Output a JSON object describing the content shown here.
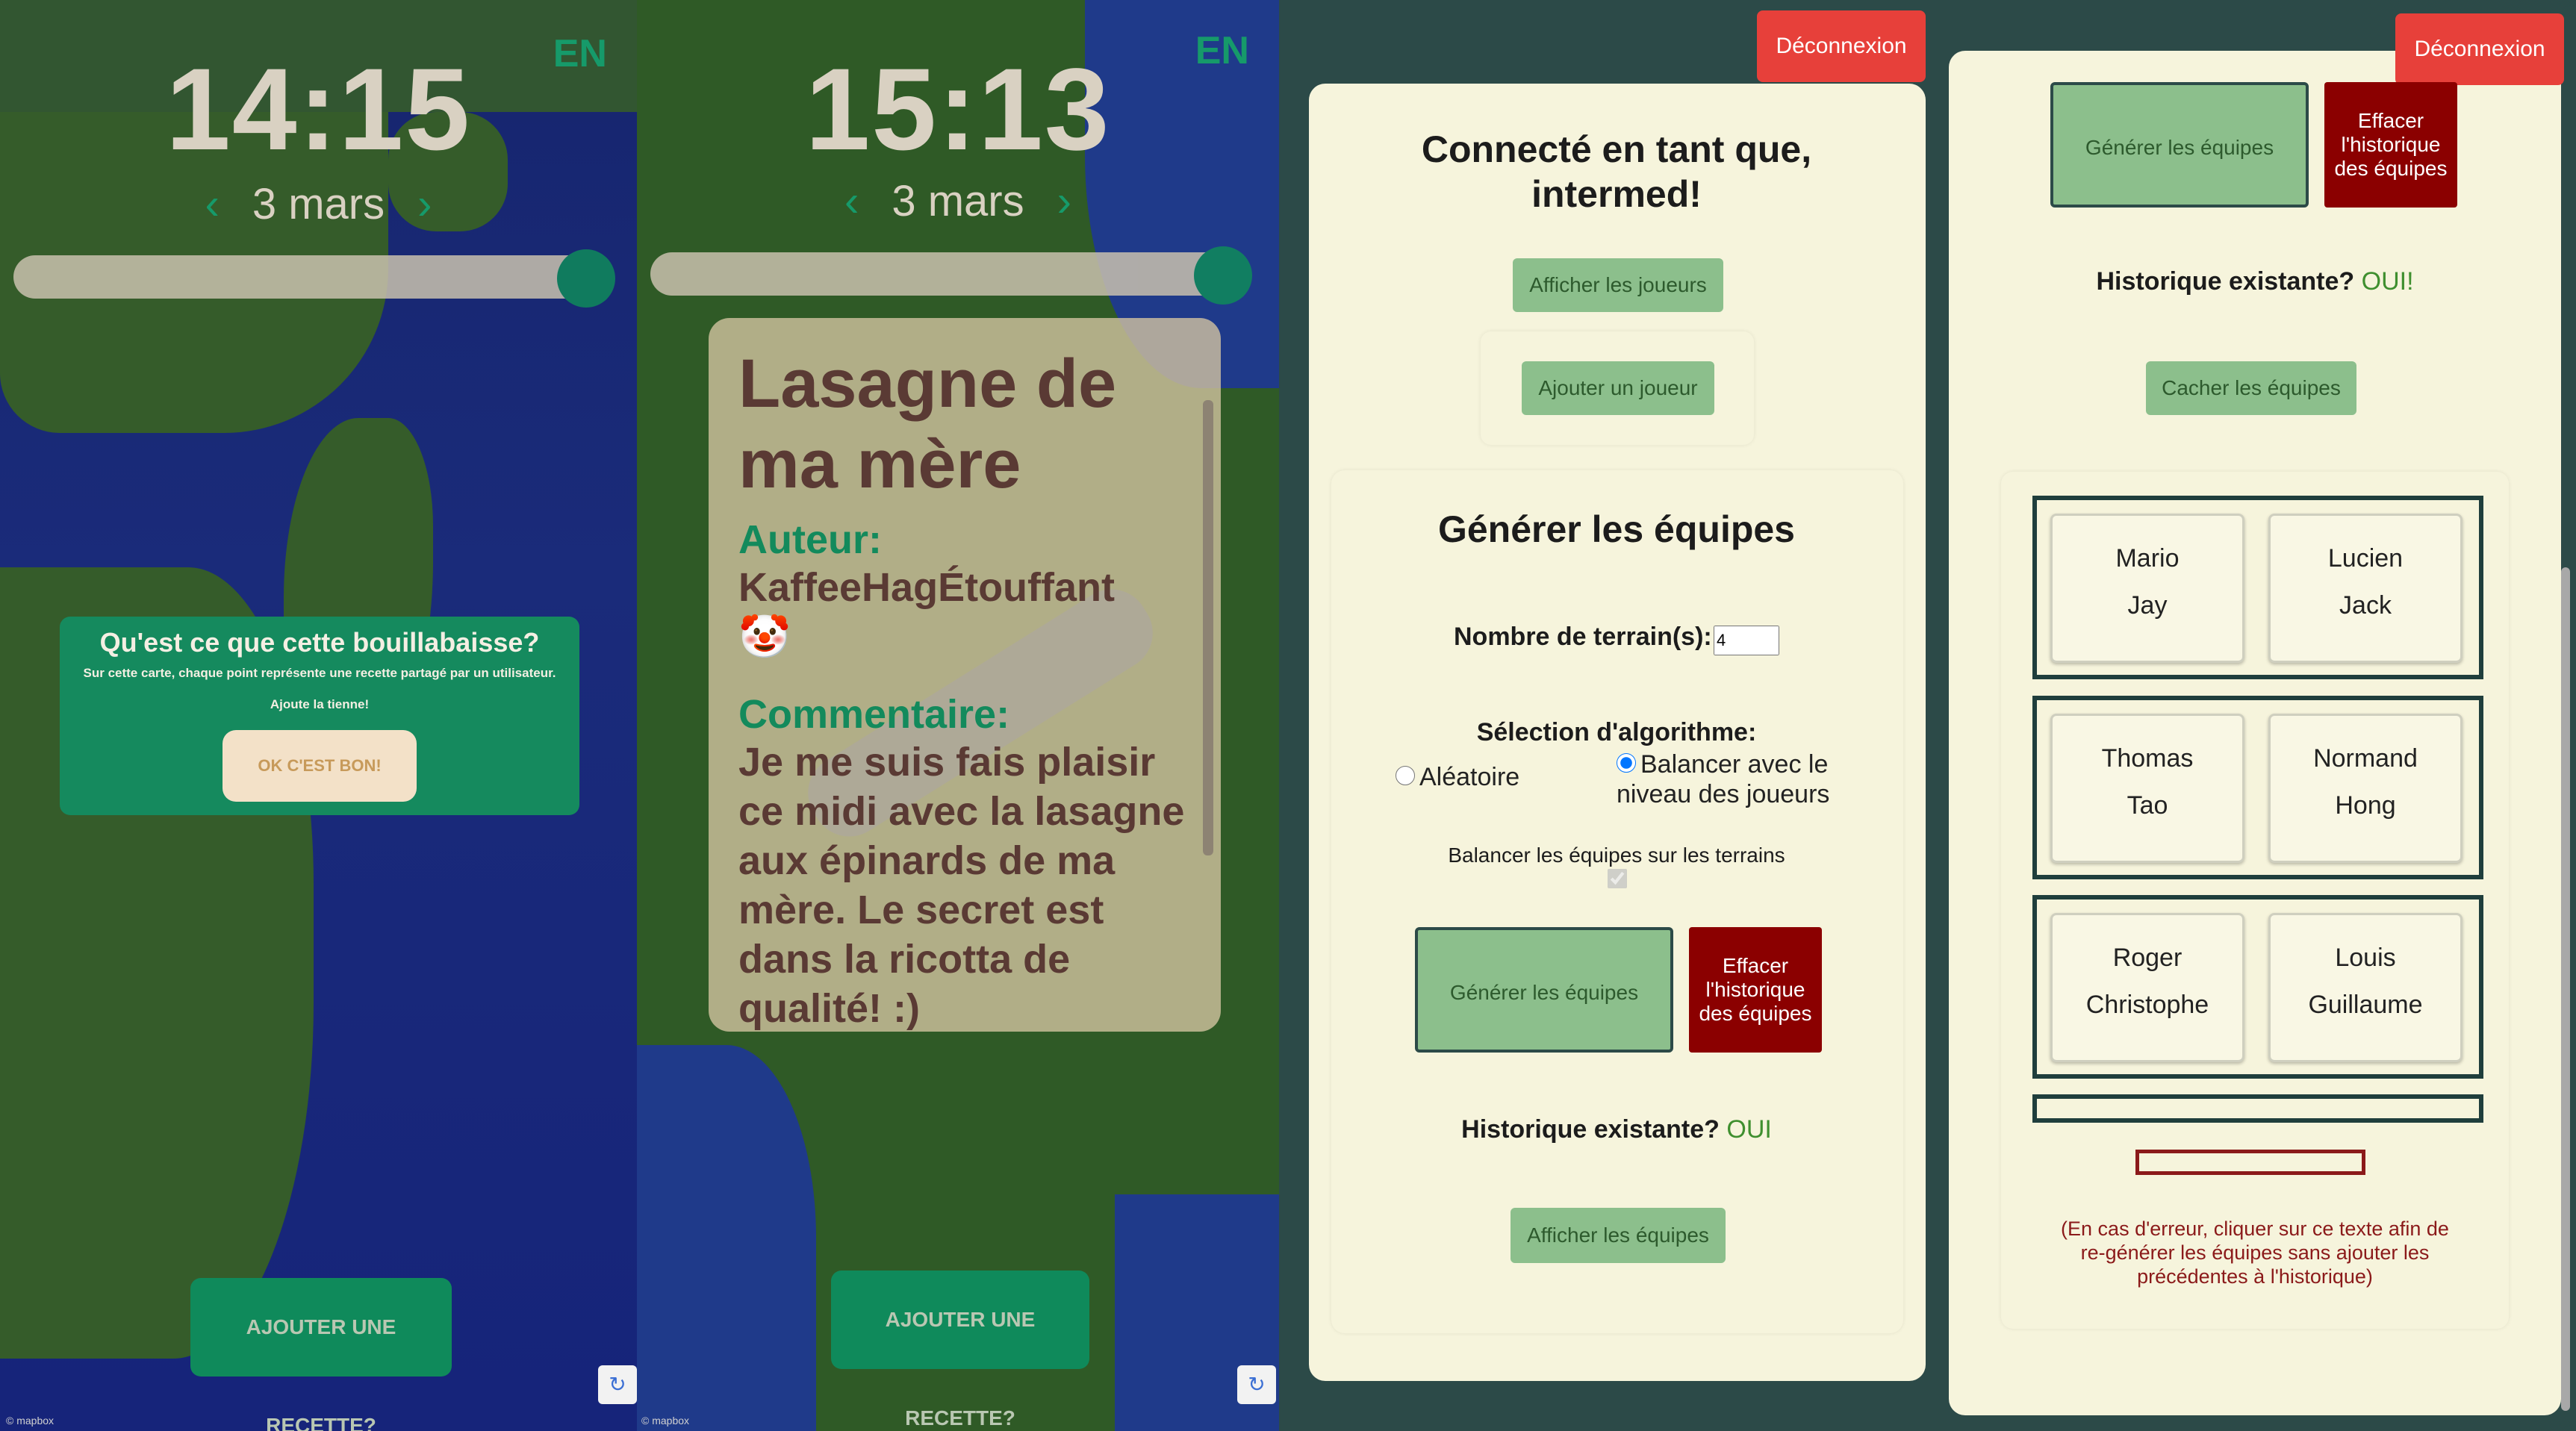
{
  "map1": {
    "time": "14:15",
    "lang": "EN",
    "date": "3 mars",
    "info": {
      "title": "Qu'est ce que cette bouillabaisse?",
      "line1": "Sur cette carte, chaque point représente une recette partagé par un utilisateur.",
      "line2": "Ajoute la tienne!",
      "ok": "OK C'EST BON!"
    },
    "add_recipe": "AJOUTER UNE RECETTE?",
    "credit": "© mapbox"
  },
  "map2": {
    "time": "15:13",
    "lang": "EN",
    "date": "3 mars",
    "recipe": {
      "title": "Lasagne de ma mère",
      "author_label": "Auteur:",
      "author": "KaffeeHagÉtouffant",
      "emoji": "🤡",
      "comment_label": "Commentaire:",
      "comment": "Je me suis fais plaisir ce midi avec la lasagne aux épinards de ma mère. Le secret est dans la ricotta de qualité! :)"
    },
    "add_recipe": "AJOUTER UNE RECETTE?",
    "credit": "© mapbox"
  },
  "admin1": {
    "logout": "Déconnexion",
    "connected": "Connecté en tant que, intermed!",
    "show_players": "Afficher les joueurs",
    "add_player": "Ajouter un joueur",
    "gen_title": "Générer les équipes",
    "fields_label": "Nombre de terrain(s):",
    "fields_value": "4",
    "algo_label": "Sélection d'algorithme:",
    "algo_random": "Aléatoire",
    "algo_balance": "Balancer avec le niveau des joueurs",
    "balance_fields": "Balancer les équipes sur les terrains",
    "generate": "Générer les équipes",
    "clear_history": "Effacer l'historique des équipes",
    "history_label": "Historique existante?",
    "history_value": "OUI",
    "show_teams": "Afficher les équipes"
  },
  "admin2": {
    "logout": "Déconnexion",
    "generate": "Générer les équipes",
    "clear_history": "Effacer l'historique des équipes",
    "history_label": "Historique existante?",
    "history_value": "OUI!",
    "hide_teams": "Cacher les équipes",
    "teams": [
      {
        "a": [
          "Mario",
          "Jay"
        ],
        "b": [
          "Lucien",
          "Jack"
        ]
      },
      {
        "a": [
          "Thomas",
          "Tao"
        ],
        "b": [
          "Normand",
          "Hong"
        ]
      },
      {
        "a": [
          "Roger",
          "Christophe"
        ],
        "b": [
          "Louis",
          "Guillaume"
        ]
      }
    ],
    "error_note": "(En cas d'erreur, cliquer sur ce texte afin de re-générer les équipes sans ajouter les précédentes à l'historique)"
  },
  "colors": {
    "accent_green": "#0f8a5b",
    "logout_red": "#e7403a",
    "dark_red": "#8b0000",
    "button_green": "#8cbf8c",
    "card_bg": "#f6f4dc"
  }
}
